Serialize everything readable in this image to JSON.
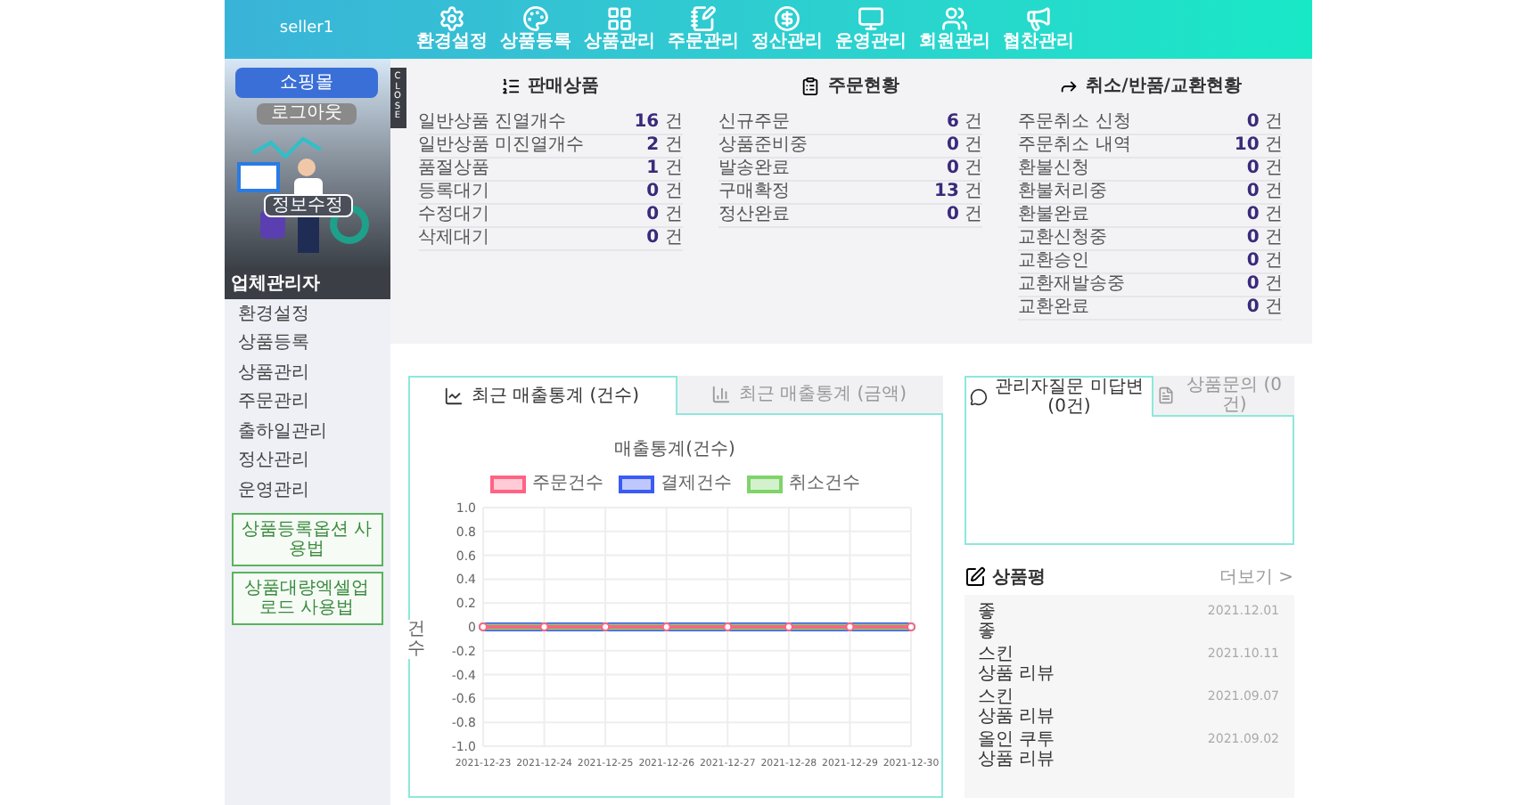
{
  "header": {
    "user": "seller1",
    "nav": [
      {
        "label": "환경설정"
      },
      {
        "label": "상품등록"
      },
      {
        "label": "상품관리"
      },
      {
        "label": "주문관리"
      },
      {
        "label": "정산관리"
      },
      {
        "label": "운영관리"
      },
      {
        "label": "회원관리"
      },
      {
        "label": "협찬관리"
      }
    ]
  },
  "sidebar": {
    "shop_button": "쇼핑몰",
    "logout_button": "로그아웃",
    "edit_button": "정보수정",
    "close_tab": "CLOSE",
    "role": "업체관리자",
    "items": [
      {
        "label": "환경설정"
      },
      {
        "label": "상품등록"
      },
      {
        "label": "상품관리"
      },
      {
        "label": "주문관리"
      },
      {
        "label": "출하일관리"
      },
      {
        "label": "정산관리"
      },
      {
        "label": "운영관리"
      }
    ],
    "guide_buttons": [
      "상품등록옵션 사용법",
      "상품대량엑셀업로드 사용법"
    ]
  },
  "stats": [
    {
      "title": "판매상품",
      "rows": [
        {
          "label": "일반상품 진열개수",
          "value": "**16** 건"
        },
        {
          "label": "일반상품 미진열개수",
          "value": "**2** 건"
        },
        {
          "label": "품절상품",
          "value": "**1** 건"
        },
        {
          "label": "등록대기",
          "value": "**0** 건"
        },
        {
          "label": "수정대기",
          "value": "**0** 건"
        },
        {
          "label": "삭제대기",
          "value": "**0** 건"
        }
      ]
    },
    {
      "title": "주문현황",
      "rows": [
        {
          "label": "신규주문",
          "value": "**6** 건"
        },
        {
          "label": "상품준비중",
          "value": "**0** 건"
        },
        {
          "label": "발송완료",
          "value": "**0** 건"
        },
        {
          "label": "구매확정",
          "value": "**13** 건"
        },
        {
          "label": "정산완료",
          "value": "**0** 건"
        }
      ]
    },
    {
      "title": "취소/반품/교환현황",
      "rows": [
        {
          "label": "주문취소 신청",
          "value": "**0** 건"
        },
        {
          "label": "주문취소 내역",
          "value": "**10** 건"
        },
        {
          "label": "환불신청",
          "value": "**0** 건"
        },
        {
          "label": "환불처리중",
          "value": "**0** 건"
        },
        {
          "label": "환불완료",
          "value": "**0** 건"
        },
        {
          "label": "교환신청중",
          "value": "**0** 건"
        },
        {
          "label": "교환승인",
          "value": "**0** 건"
        },
        {
          "label": "교환재발송중",
          "value": "**0** 건"
        },
        {
          "label": "교환완료",
          "value": "**0** 건"
        }
      ]
    }
  ],
  "sales_panel": {
    "tabs": [
      {
        "label": "최근 매출통계 (건수)",
        "selected": true
      },
      {
        "label": "최근 매출통계 (금액)",
        "selected": false
      }
    ],
    "chart_data": {
      "type": "line",
      "title": "매출통계(건수)",
      "ylabel": "건수",
      "grid": true,
      "legend": true,
      "categories": [
        "2021-12-23",
        "2021-12-24",
        "2021-12-25",
        "2021-12-26",
        "2021-12-27",
        "2021-12-28",
        "2021-12-29",
        "2021-12-30"
      ],
      "series": [
        {
          "name": "주문건수",
          "color": "#ff6384",
          "marker": "circle",
          "values": [
            0,
            0,
            0,
            0,
            0,
            0,
            0,
            0
          ]
        },
        {
          "name": "결제건수",
          "color": "#3b5bf5",
          "marker": "circle",
          "values": [
            0,
            0,
            0,
            0,
            0,
            0,
            0,
            0
          ]
        },
        {
          "name": "취소건수",
          "color": "#7fd46a",
          "marker": "circle",
          "values": [
            0,
            0,
            0,
            0,
            0,
            0,
            0,
            0
          ]
        }
      ],
      "ylim": [
        -1,
        1
      ],
      "yticks": [
        {
          "value": 1,
          "label": "1.0"
        },
        {
          "value": 0.8,
          "label": "0.8"
        },
        {
          "value": 0.6,
          "label": "0.6"
        },
        {
          "value": 0.4,
          "label": "0.4"
        },
        {
          "value": 0.2,
          "label": "0.2"
        },
        {
          "value": 0,
          "label": "0"
        },
        {
          "value": -0.2,
          "label": "-0.2"
        },
        {
          "value": -0.4,
          "label": "-0.4"
        },
        {
          "value": -0.6,
          "label": "-0.6"
        },
        {
          "value": -0.8,
          "label": "-0.8"
        },
        {
          "value": -1,
          "label": "-1.0"
        }
      ]
    }
  },
  "inquiry_panel": {
    "tabs": [
      {
        "label": "관리자질문 미답변 (0건)",
        "selected": true
      },
      {
        "label": "상품문의 (0건)",
        "selected": false
      }
    ]
  },
  "reviews": {
    "title": "상품평",
    "more_link": "더보기 >",
    "items": [
      {
        "title": "좋",
        "body": "좋",
        "date": "2021.12.01"
      },
      {
        "title": "스킨",
        "body": "상품 리뷰",
        "date": "2021.10.11"
      },
      {
        "title": "스킨",
        "body": "상품 리뷰",
        "date": "2021.09.07"
      },
      {
        "title": "올인 쿠투",
        "body": "상품 리뷰",
        "date": "2021.09.02"
      }
    ]
  }
}
